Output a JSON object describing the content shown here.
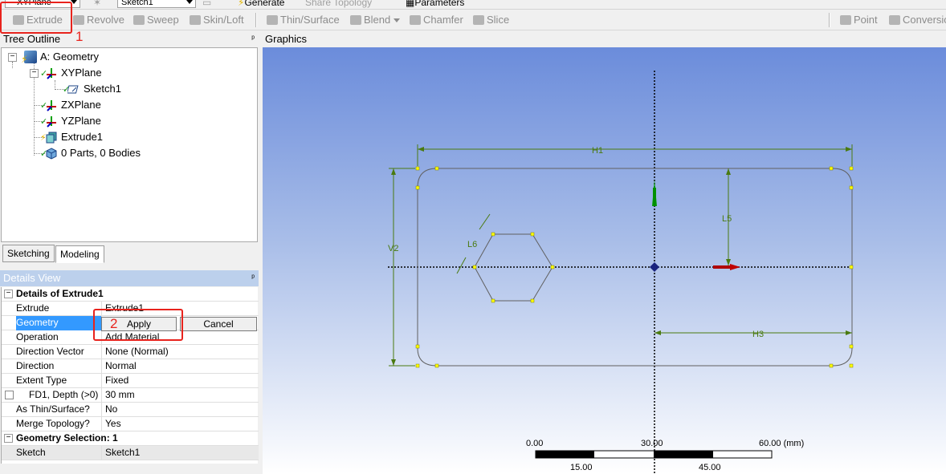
{
  "top_row": {
    "plane_combo": "XYPlane",
    "sketch_combo": "Sketch1",
    "generate_label": "Generate",
    "share_topology_label": "Share Topology",
    "parameters_label": "Parameters"
  },
  "toolbar": {
    "items": [
      "Extrude",
      "Revolve",
      "Sweep",
      "Skin/Loft",
      "Thin/Surface",
      "Blend",
      "Chamfer",
      "Slice",
      "Point",
      "Conversion"
    ]
  },
  "annotations": {
    "marker_1": "1",
    "marker_2": "2"
  },
  "tree_outline": {
    "title": "Tree Outline",
    "pin": "ᵖ",
    "nodes": [
      "A: Geometry",
      "XYPlane",
      "Sketch1",
      "ZXPlane",
      "YZPlane",
      "Extrude1",
      "0 Parts, 0 Bodies"
    ]
  },
  "tabs": {
    "sketching": "Sketching",
    "modeling": "Modeling"
  },
  "details_view": {
    "title": "Details View",
    "pin": "ᵖ",
    "section_title": "Details of Extrude1",
    "rows": [
      {
        "key": "Extrude",
        "value": "Extrude1"
      },
      {
        "key": "Geometry",
        "value": ""
      },
      {
        "key": "Operation",
        "value": "Add Material"
      },
      {
        "key": "Direction Vector",
        "value": "None (Normal)"
      },
      {
        "key": "Direction",
        "value": "Normal"
      },
      {
        "key": "Extent Type",
        "value": "Fixed"
      },
      {
        "key": "FD1,  Depth (>0)",
        "value": "30 mm"
      },
      {
        "key": "As Thin/Surface?",
        "value": "No"
      },
      {
        "key": "Merge Topology?",
        "value": "Yes"
      }
    ],
    "section2_title": "Geometry Selection: 1",
    "sketch_row": {
      "key": "Sketch",
      "value": "Sketch1"
    },
    "apply_label": "Apply",
    "cancel_label": "Cancel"
  },
  "graphics": {
    "title": "Graphics",
    "dimension_labels": [
      "H1",
      "V2",
      "L5",
      "L6",
      "H3"
    ],
    "scale": {
      "top_labels": [
        "0.00",
        "30.00",
        "60.00 (mm)"
      ],
      "bottom_labels": [
        "15.00",
        "45.00"
      ]
    },
    "colors": {
      "sketch_line": "#555555",
      "dimension": "#4a7a10",
      "vertex": "#ffff00",
      "axis_x": "#c00000",
      "axis_y": "#00a000"
    }
  }
}
